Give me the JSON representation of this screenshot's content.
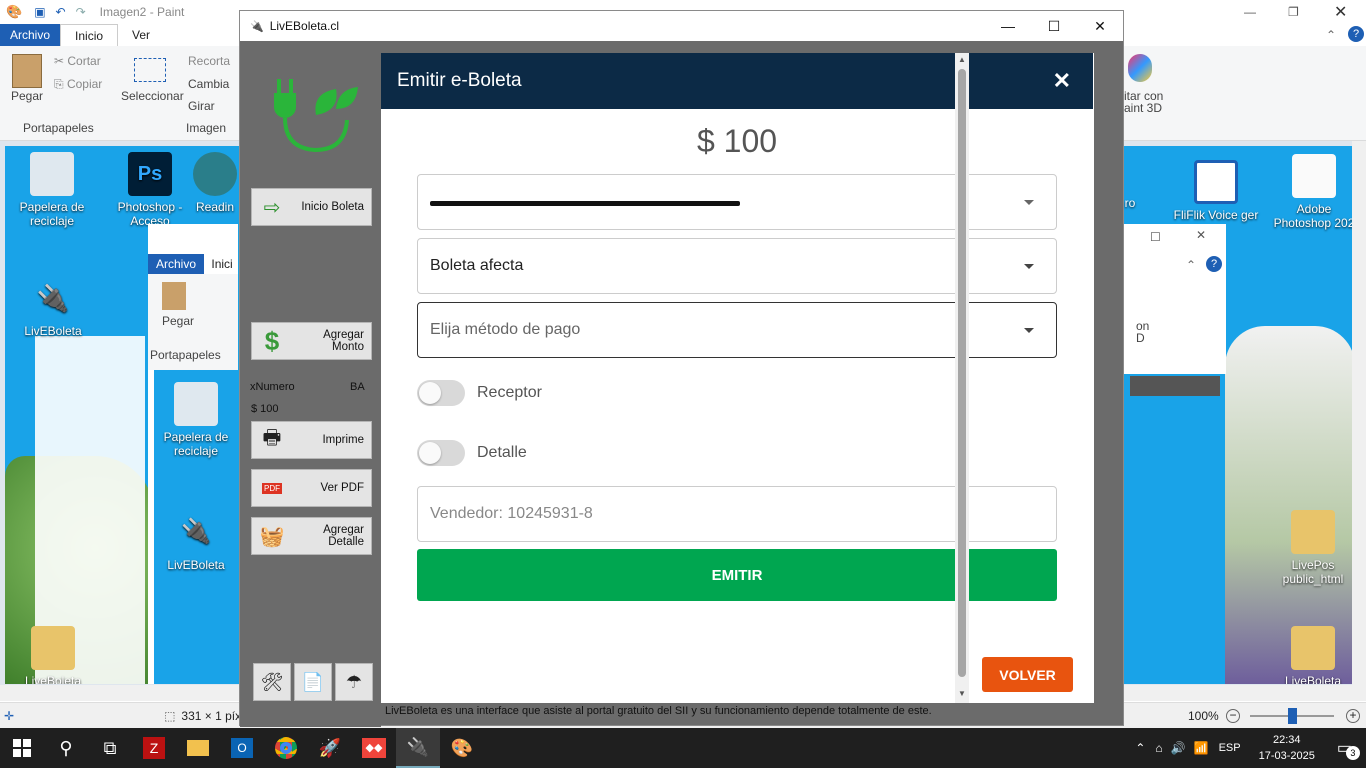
{
  "paint": {
    "title": "Imagen2 - Paint",
    "tabs": [
      "Archivo",
      "Inicio",
      "Ver"
    ],
    "ribbon": {
      "pegar": "Pegar",
      "cortar": "Cortar",
      "copiar": "Copiar",
      "group_portapapeles": "Portapapeles",
      "seleccionar": "Seleccionar",
      "recortar": "Recorta",
      "cambiar": "Cambia",
      "girar": "Girar",
      "group_imagen": "Imagen",
      "editar3d": "itar con\naint 3D"
    },
    "status": {
      "dimensions": "331 × 1 píxe",
      "zoom": "100%"
    }
  },
  "desktop": {
    "icons": [
      {
        "label": "Papelera de reciclaje"
      },
      {
        "label": "Photoshop - Acceso"
      },
      {
        "label": "Readin"
      },
      {
        "label": "LivEBoleta"
      },
      {
        "label": "LiveBoleta"
      },
      {
        "label": "ro"
      },
      {
        "label": "FliFlik Voice ger"
      },
      {
        "label": "Adobe Photoshop 202"
      },
      {
        "label": "LivePos public_html"
      },
      {
        "label": "LiveBoleta"
      }
    ],
    "inner_paint": {
      "tabs": [
        "Archivo",
        "Inici"
      ],
      "pegar": "Pegar",
      "portapapeles": "Portapapeles",
      "papelera": "Papelera de reciclaje",
      "livebolet": "LivEBoleta",
      "edit_fragment": "on\nD"
    }
  },
  "app": {
    "title": "LivEBoleta.cl",
    "sidebar": {
      "inicio": "Inicio Boleta",
      "agregar_monto": "Agregar Monto",
      "xnumero": "xNumero",
      "ba": "BA",
      "monto": "$ 100",
      "imprime": "Imprime",
      "ver_pdf": "Ver PDF",
      "agregar_detalle": "Agregar Detalle"
    },
    "footer": "LivEBoleta es una interface que asiste al portal gratuito del SII y su funcionamiento depende totalmente de este."
  },
  "dialog": {
    "title": "Emitir e-Boleta",
    "amount": "$ 100",
    "select1_value": "",
    "select2_value": "Boleta afecta",
    "select3_placeholder": "Elija método de pago",
    "toggle_receptor": "Receptor",
    "toggle_detalle": "Detalle",
    "vendedor_placeholder": "Vendedor: 10245931-8",
    "emitir": "EMITIR",
    "volver": "VOLVER"
  },
  "taskbar": {
    "language": "ESP",
    "time": "22:34",
    "date": "17-03-2025",
    "notifications": "3"
  },
  "colors": {
    "dialog_header": "#0c2a46",
    "emitir": "#00a650",
    "volver": "#e8540f",
    "desktop": "#19a3e8"
  }
}
